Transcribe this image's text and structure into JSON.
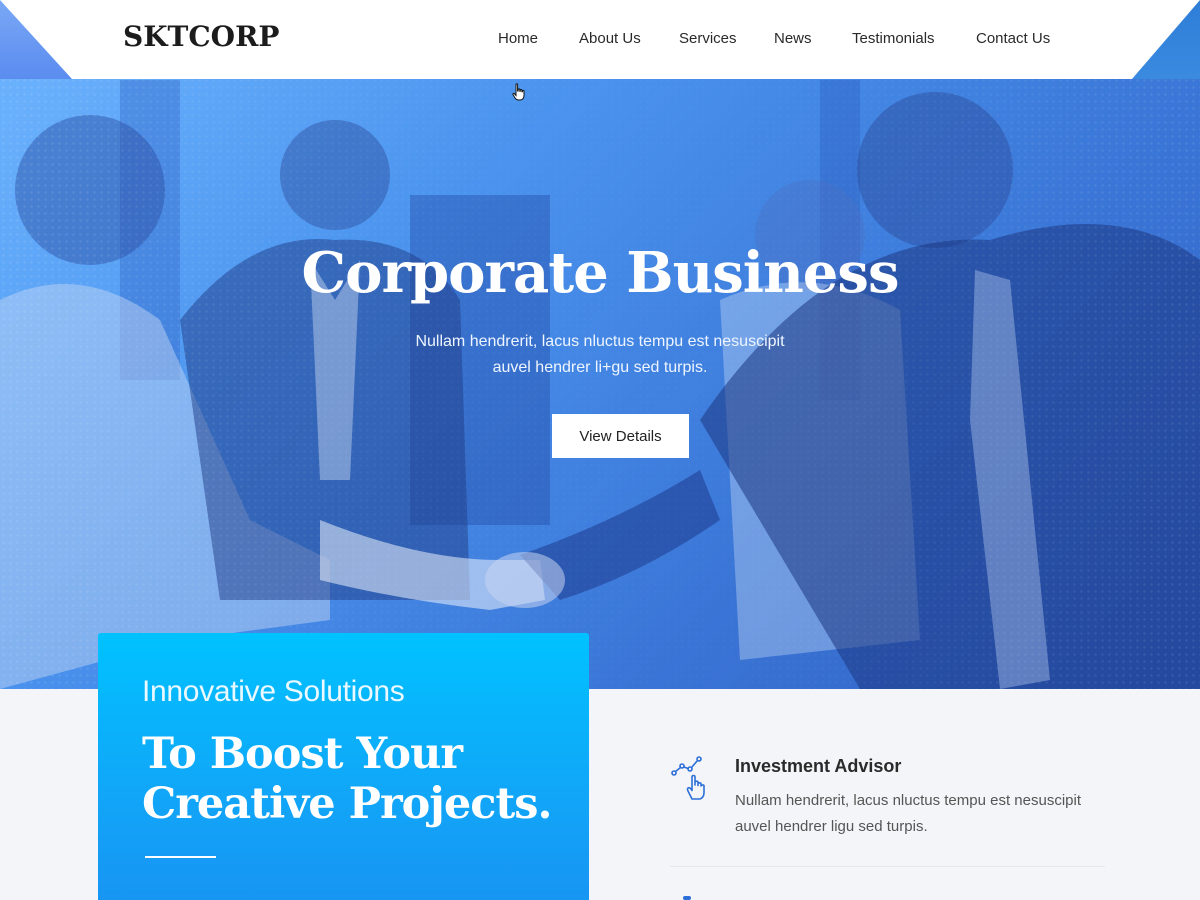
{
  "header": {
    "logo": "SKTCORP",
    "menu": [
      "Home",
      "About Us",
      "Services",
      "News",
      "Testimonials",
      "Contact Us"
    ]
  },
  "hero": {
    "title": "Corporate Business",
    "subtitle_line1": "Nullam hendrerit, lacus nluctus tempu est nesuscipit",
    "subtitle_line2": "auvel hendrer li+gu  sed turpis.",
    "button_label": "View Details"
  },
  "promo": {
    "kicker": "Innovative Solutions",
    "title_line1": "To Boost Your",
    "title_line2": "Creative Projects."
  },
  "features": [
    {
      "icon": "growth-chart-hand-icon",
      "title": "Investment Advisor",
      "description": "Nullam hendrerit, lacus nluctus tempu est nesuscipit auvel hendrer ligu  sed turpis."
    }
  ],
  "colors": {
    "accent": "#00c2ff",
    "hero_overlay": "#3a75d6",
    "icon_blue": "#2d6fd8"
  }
}
